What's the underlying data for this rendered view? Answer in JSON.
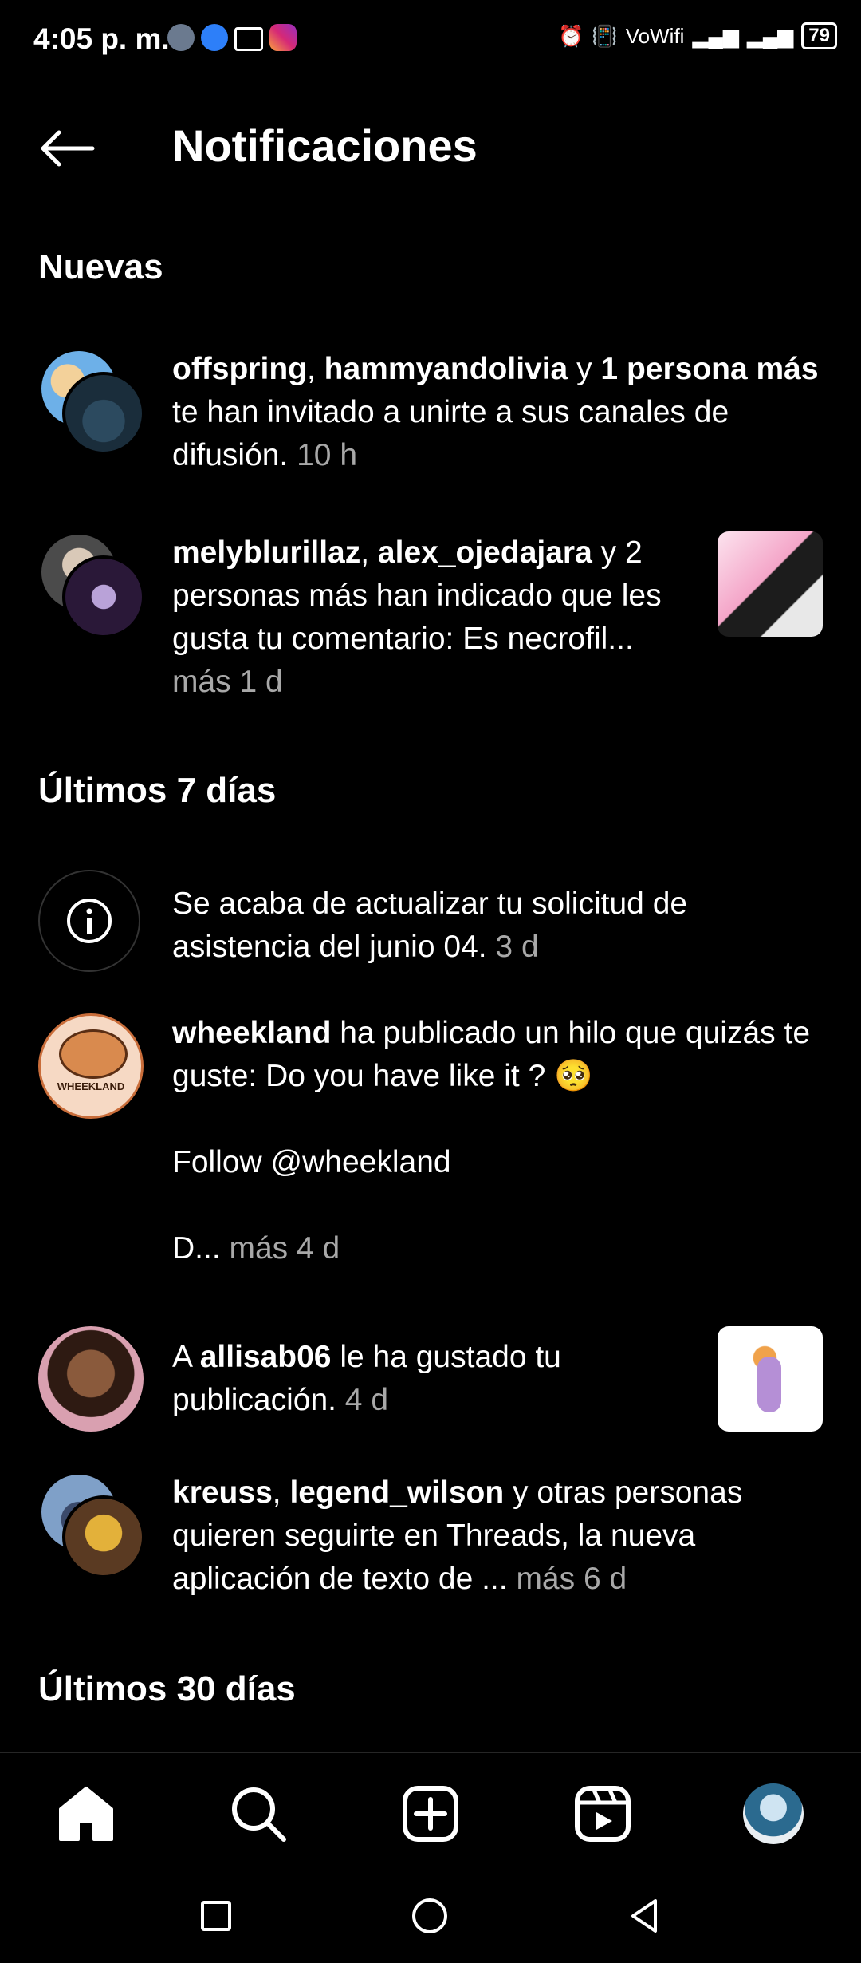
{
  "status_bar": {
    "time": "4:05 p. m.",
    "network": "VoWifi",
    "battery": "79"
  },
  "header": {
    "title": "Notificaciones"
  },
  "sections": {
    "new": "Nuevas",
    "last7": "Últimos 7 días",
    "last30": "Últimos 30 días"
  },
  "notifications": [
    {
      "user1": "offspring",
      "sep": ", ",
      "user2": "hammyandolivia",
      "mid": " y ",
      "bold3": "1 persona más",
      "text": " te han invitado a unirte a sus canales de difusión.",
      "time": " 10 h"
    },
    {
      "user1": "melyblurillaz",
      "sep": ", ",
      "user2": "alex_ojedajara",
      "text": " y 2 personas más han indicado que les gusta tu comentario: Es necrofil...",
      "more": " más",
      "time": " 1 d"
    },
    {
      "text": "Se acaba de actualizar tu solicitud de asistencia del junio 04.",
      "time": " 3 d"
    },
    {
      "user1": "wheekland",
      "text": " ha publicado un hilo que quizás te guste: Do you have like it ? 🥺",
      "line2": "Follow @wheekland",
      "line3": "D...",
      "more": " más",
      "time": " 4 d",
      "avatar_label": "WHEEKLAND"
    },
    {
      "prefix": "A ",
      "user1": "allisab06",
      "text": " le ha gustado tu publicación.",
      "time": " 4 d"
    },
    {
      "user1": "kreuss",
      "sep": ", ",
      "user2": "legend_wilson",
      "text": " y otras personas quieren seguirte en Threads, la nueva aplicación de texto de ...",
      "more": " más",
      "time": " 6 d"
    }
  ],
  "nav": [
    "home-icon",
    "search-icon",
    "create-icon",
    "reels-icon",
    "profile-avatar"
  ],
  "colors": {
    "background": "#000000",
    "muted": "#a8a8a8",
    "text": "#ffffff"
  }
}
